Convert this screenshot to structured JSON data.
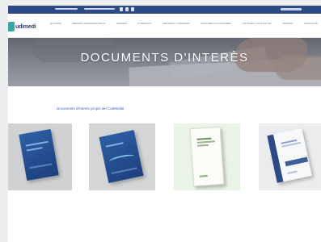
{
  "site": {
    "logo_text": "udimedi"
  },
  "nav": {
    "items": [
      "Qui som",
      "Serveis professionals",
      "Serveis",
      "Formació",
      "Centres i convenis",
      "Documents d'interès",
      "Notícies i actualitat",
      "Premsa",
      "Contacte"
    ]
  },
  "hero": {
    "title": "DOCUMENTS D'INTERÈS"
  },
  "intro": {
    "text": "Documents d'interès propis del CatMediat"
  },
  "documents": [
    {
      "name": "document-1",
      "cover": "blue"
    },
    {
      "name": "document-2",
      "cover": "blue-wave"
    },
    {
      "name": "document-3",
      "cover": "white-green"
    },
    {
      "name": "document-4",
      "cover": "white-navy"
    }
  ],
  "colors": {
    "brand_navy": "#2d4a87",
    "brand_teal": "#35a9a7",
    "link_blue": "#3c66b3"
  }
}
